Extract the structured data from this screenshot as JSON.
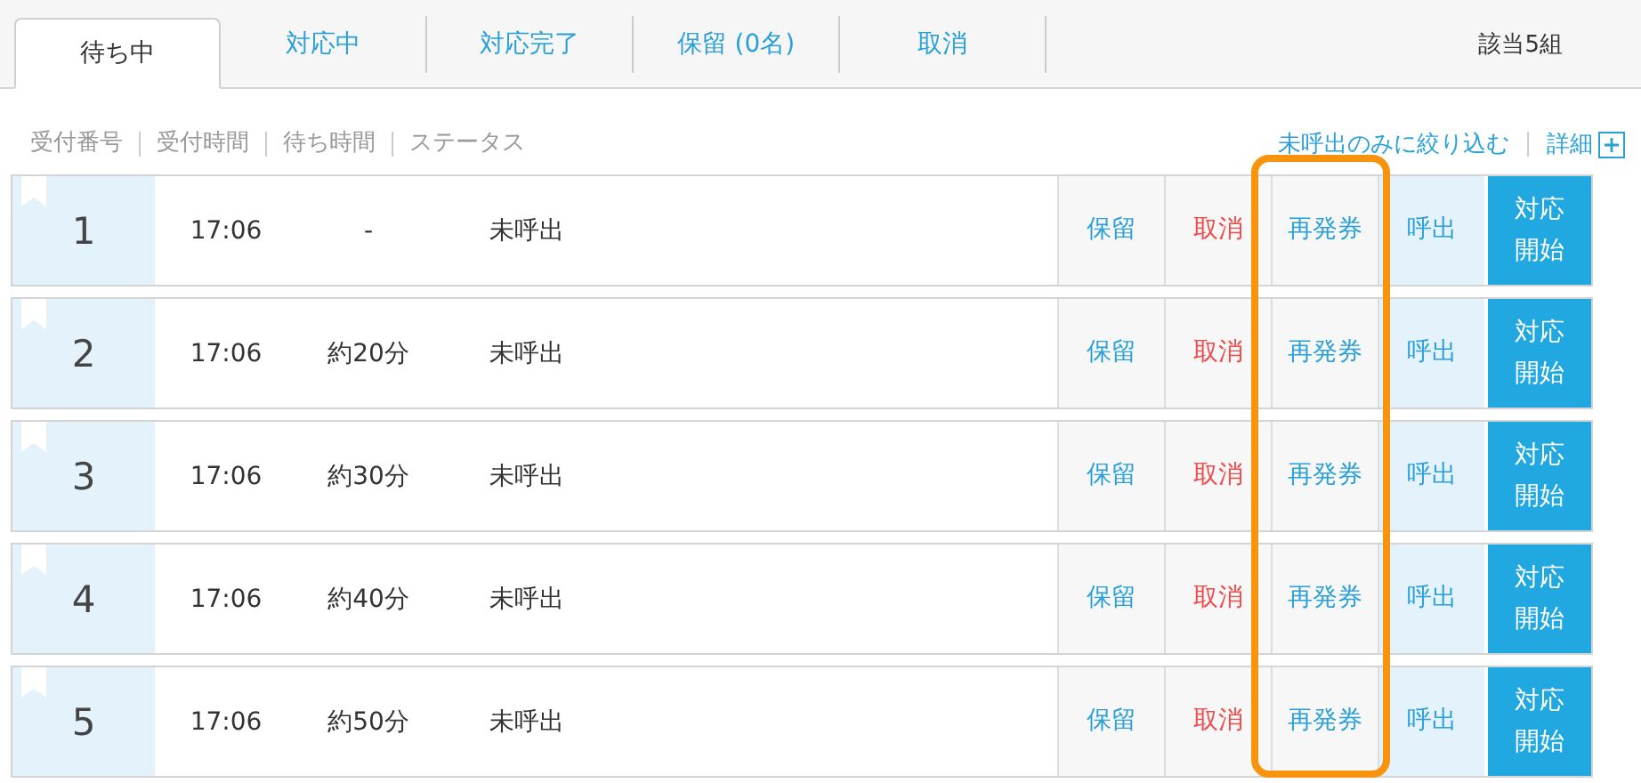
{
  "tabs": [
    {
      "label": "待ち中",
      "selected": true
    },
    {
      "label": "対応中",
      "selected": false
    },
    {
      "label": "対応完了",
      "selected": false
    },
    {
      "label": "保留 (0名)",
      "selected": false
    },
    {
      "label": "取消",
      "selected": false
    }
  ],
  "count": "該当5組",
  "columns": [
    "受付番号",
    "受付時間",
    "待ち時間",
    "ステータス"
  ],
  "filter_link": "未呼出のみに絞り込む",
  "detail_link": "詳細",
  "highlight_frame": true,
  "rows": [
    {
      "number": "1",
      "time": "17:06",
      "wait": "-",
      "status": "未呼出",
      "actions": [
        {
          "kind": "hold",
          "label": "保留"
        },
        {
          "kind": "cancel",
          "label": "取消"
        },
        {
          "kind": "reissue",
          "label": "再発券"
        },
        {
          "kind": "call",
          "label": "呼出"
        },
        {
          "kind": "start",
          "label": "対応開始"
        }
      ]
    },
    {
      "number": "2",
      "time": "17:06",
      "wait": "約20分",
      "status": "未呼出",
      "actions": [
        {
          "kind": "hold",
          "label": "保留"
        },
        {
          "kind": "cancel",
          "label": "取消"
        },
        {
          "kind": "reissue",
          "label": "再発券"
        },
        {
          "kind": "call",
          "label": "呼出"
        },
        {
          "kind": "start",
          "label": "対応開始"
        }
      ]
    },
    {
      "number": "3",
      "time": "17:06",
      "wait": "約30分",
      "status": "未呼出",
      "actions": [
        {
          "kind": "hold",
          "label": "保留"
        },
        {
          "kind": "cancel",
          "label": "取消"
        },
        {
          "kind": "reissue",
          "label": "再発券"
        },
        {
          "kind": "call",
          "label": "呼出"
        },
        {
          "kind": "start",
          "label": "対応開始"
        }
      ]
    },
    {
      "number": "4",
      "time": "17:06",
      "wait": "約40分",
      "status": "未呼出",
      "actions": [
        {
          "kind": "hold",
          "label": "保留"
        },
        {
          "kind": "cancel",
          "label": "取消"
        },
        {
          "kind": "reissue",
          "label": "再発券"
        },
        {
          "kind": "call",
          "label": "呼出"
        },
        {
          "kind": "start",
          "label": "対応開始"
        }
      ]
    },
    {
      "number": "5",
      "time": "17:06",
      "wait": "約50分",
      "status": "未呼出",
      "actions": [
        {
          "kind": "hold",
          "label": "保留"
        },
        {
          "kind": "cancel",
          "label": "取消"
        },
        {
          "kind": "reissue",
          "label": "再発券"
        },
        {
          "kind": "call",
          "label": "呼出"
        },
        {
          "kind": "start",
          "label": "対応開始"
        }
      ]
    }
  ]
}
